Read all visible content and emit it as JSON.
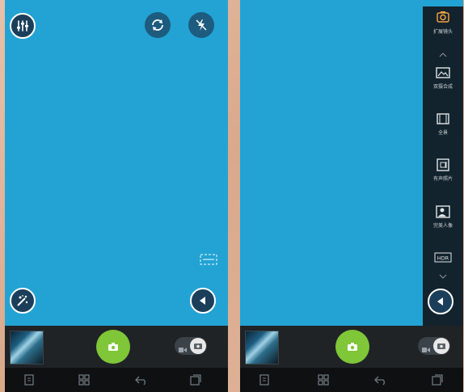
{
  "left_screen": {
    "top_left_icon": "equalizer-icon",
    "top_right_icons": [
      "switch-camera-icon",
      "flash-off-icon"
    ],
    "bottom_left_icon": "magic-wand-icon",
    "bottom_right_icon": "expand-left-arrow-icon",
    "crop_icon": "wide-crop-icon"
  },
  "right_screen": {
    "menu_items": [
      {
        "icon": "camera-mode-icon",
        "label": "扩展镜头"
      },
      {
        "icon": "chevron-up-icon",
        "label": ""
      },
      {
        "icon": "landscape-icon",
        "label": "双摄合成"
      },
      {
        "icon": "panorama-icon",
        "label": "全景"
      },
      {
        "icon": "sound-photo-icon",
        "label": "有声照片"
      },
      {
        "icon": "beauty-portrait-icon",
        "label": "完美人像"
      },
      {
        "icon": "hdr-icon",
        "label": "HDR"
      }
    ],
    "collapse_icon": "collapse-arrow-icon"
  },
  "bottom_bar": {
    "gallery_icon": "gallery-thumbnail",
    "shutter_icon": "camera-icon",
    "mode_toggle_icon": "video-photo-toggle-icon"
  },
  "nav_bar": [
    "menu-icon",
    "apps-icon",
    "back-icon",
    "recents-icon"
  ],
  "colors": {
    "viewfinder": "#22a3d4",
    "shutter": "#7fc638",
    "bar": "#1f2326"
  }
}
